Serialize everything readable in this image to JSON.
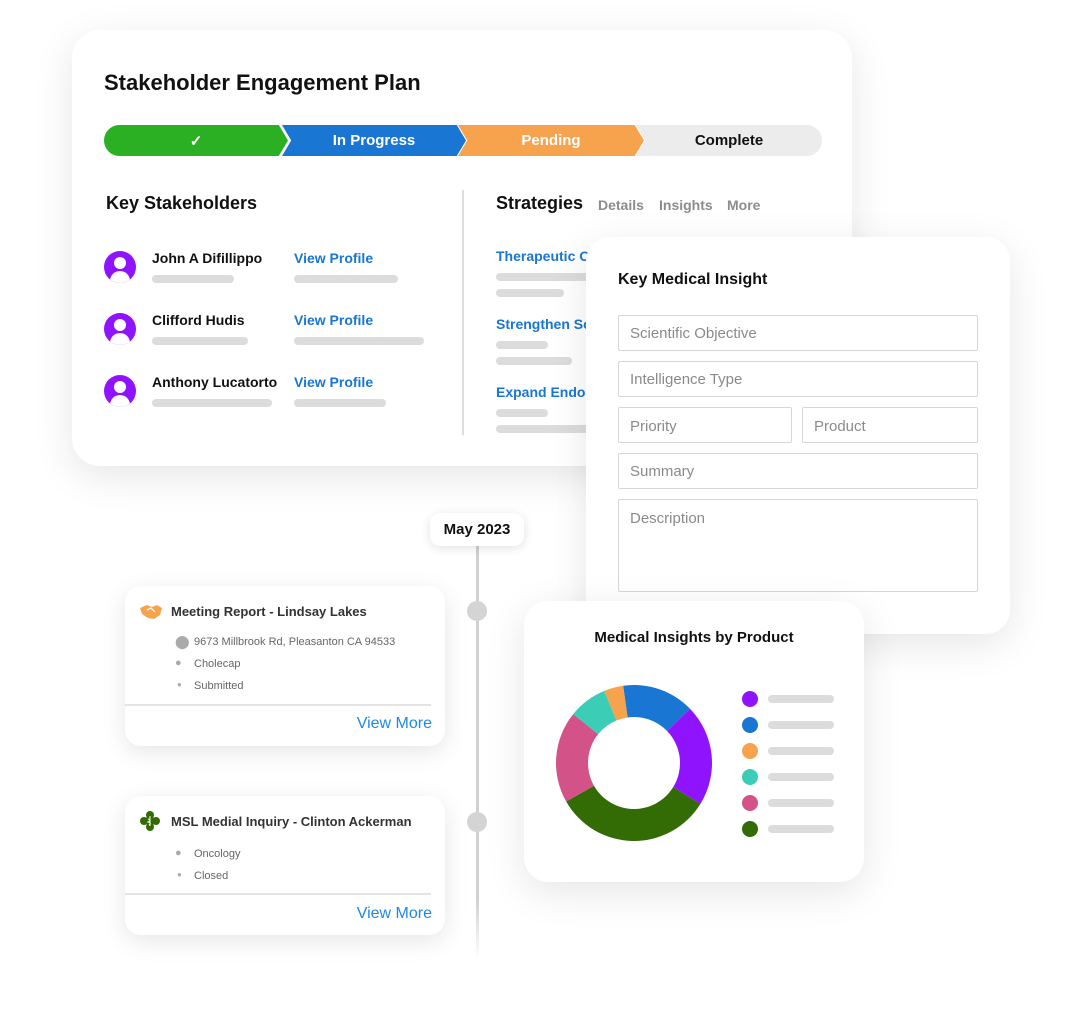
{
  "plan": {
    "title": "Stakeholder Engagement Plan",
    "steps": [
      {
        "label": "✓",
        "color": "#2bb024"
      },
      {
        "label": "In Progress",
        "color": "#1976d2"
      },
      {
        "label": "Pending",
        "color": "#f7a24d"
      },
      {
        "label": "Complete",
        "color": "#ececec"
      }
    ],
    "stakeholders_title": "Key Stakeholders",
    "stakeholders": [
      {
        "name": "John A Difillippo",
        "link": "View Profile"
      },
      {
        "name": "Clifford Hudis",
        "link": "View Profile"
      },
      {
        "name": "Anthony Lucatorto",
        "link": "View Profile"
      }
    ],
    "strategies_title": "Strategies",
    "tabs": [
      "Details",
      "Insights",
      "More"
    ],
    "strategies": [
      "Therapeutic Oı",
      "Strengthen Sc",
      "Expand Endocı"
    ]
  },
  "insight": {
    "title": "Key Medical Insight",
    "fields": [
      "Scientific Objective",
      "Intelligence Type",
      "Priority",
      "Product",
      "Summary",
      "Description"
    ]
  },
  "timeline": {
    "date": "May 2023",
    "items": [
      {
        "title": "Meeting Report - Lindsay Lakes",
        "icon": "handshake-icon",
        "address": "9673 Millbrook Rd, Pleasanton CA 94533",
        "product": "Cholecap",
        "status": "Submitted",
        "link": "View More"
      },
      {
        "title": "MSL Medial Inquiry - Clinton Ackerman",
        "icon": "medical-icon",
        "product": "Oncology",
        "status": "Closed",
        "link": "View More"
      }
    ]
  },
  "chart_data": {
    "type": "pie",
    "title": "Medical Insights by Product",
    "donut": true,
    "values": [
      15,
      21,
      33,
      19,
      8,
      4
    ],
    "colors": [
      "#1976d2",
      "#9013fe",
      "#336b05",
      "#d35287",
      "#3ccdb7",
      "#f7a24d"
    ],
    "legend_colors": [
      "#9013fe",
      "#1976d2",
      "#f7a24d",
      "#3ccdb7",
      "#d35287",
      "#336b05"
    ],
    "legend_placement": "right"
  }
}
